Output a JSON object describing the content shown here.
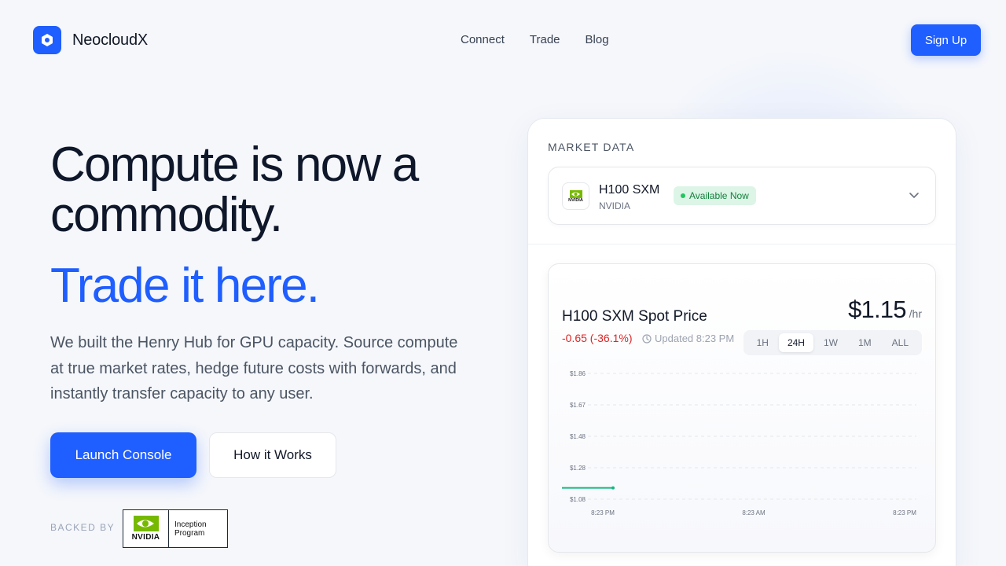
{
  "brand": {
    "name": "NeocloudX"
  },
  "nav": {
    "items": [
      "Connect",
      "Trade",
      "Blog"
    ],
    "signup": "Sign Up"
  },
  "hero": {
    "headline": "Compute is now a commodity.",
    "headline_accent": "Trade it here.",
    "subtext": "We built the Henry Hub for GPU capacity. Source compute at true market rates, hedge future costs with forwards, and instantly transfer capacity to any user.",
    "primary_cta": "Launch Console",
    "secondary_cta": "How it Works",
    "backed_by": "BACKED BY",
    "badge": {
      "brand": "NVIDIA",
      "program_line1": "Inception",
      "program_line2": "Program"
    }
  },
  "market": {
    "label": "MARKET DATA",
    "selector": {
      "name": "H100 SXM",
      "brand": "NVIDIA",
      "logo_text": "NVIDIA",
      "status": "Available Now"
    },
    "chart_card": {
      "title": "H100 SXM Spot Price",
      "change": "-0.65 (-36.1%)",
      "updated": "Updated 8:23 PM",
      "price": "$1.15",
      "unit": "/hr",
      "tabs": [
        "1H",
        "24H",
        "1W",
        "1M",
        "ALL"
      ],
      "active_tab": "24H"
    }
  },
  "colors": {
    "accent": "#1f5eff",
    "positive": "#22c55e",
    "negative": "#dc2626",
    "line": "#10b981"
  },
  "chart_data": {
    "type": "line",
    "title": "H100 SXM Spot Price",
    "y_ticks": [
      "$1.86",
      "$1.67",
      "$1.48",
      "$1.28",
      "$1.08"
    ],
    "x_ticks": [
      "8:23 PM",
      "8:23 AM",
      "8:23 PM"
    ],
    "ylim": [
      1.08,
      1.86
    ],
    "grid": true,
    "series": [
      {
        "values": [
          1.15,
          1.15,
          1.15
        ]
      }
    ]
  }
}
